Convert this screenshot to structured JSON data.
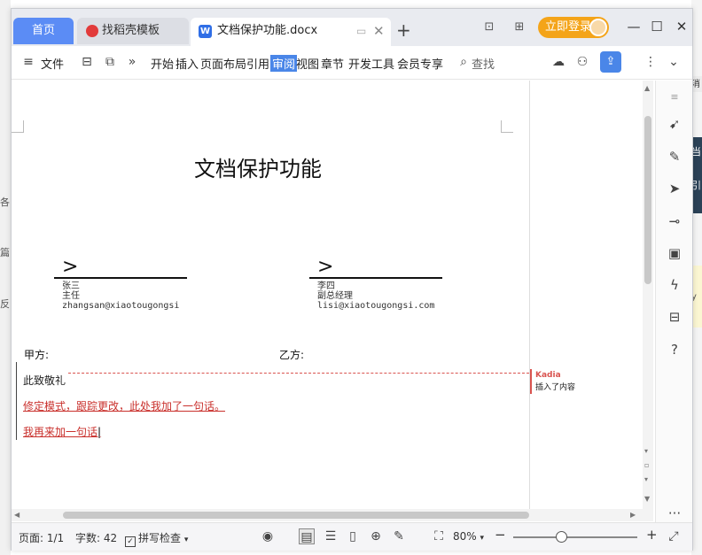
{
  "background": {
    "left_chars": [
      "各",
      "篇",
      "反"
    ],
    "right_chars": [
      "消",
      "当",
      "引",
      "y"
    ]
  },
  "titlebar": {
    "tab_home": "首页",
    "tab_template": "找稻壳模板",
    "tab_document": "文档保护功能.docx",
    "login_button": "立即登录"
  },
  "menubar": {
    "file": "文件",
    "tabs": [
      "开始",
      "插入",
      "页面布局",
      "引用",
      "审阅",
      "视图",
      "章节",
      "开发工具",
      "会员专享"
    ],
    "active_tab": "审阅",
    "search": "查找"
  },
  "document": {
    "title": "文档保护功能",
    "sig_left": {
      "name": "张三",
      "role": "主任",
      "email": "zhangsan@xiaotougongsi"
    },
    "sig_right": {
      "name": "李四",
      "role": "副总经理",
      "email": "lisi@xiaotougongsi.com"
    },
    "party_a": "甲方:",
    "party_b": "乙方:",
    "line1": "此致敬礼",
    "line2": "修定模式，跟踪更改，此处我加了一句话。",
    "line3": "我再来加一句话"
  },
  "comment": {
    "author": "Kadia",
    "text": "插入了内容"
  },
  "statusbar": {
    "page": "页面: 1/1",
    "word_count": "字数: 42",
    "spell_check": "拼写检查",
    "zoom": "80%"
  },
  "colors": {
    "accent": "#4a86e8",
    "revision": "#c9302c",
    "login": "#f4a419",
    "home_tab": "#5b8cf5"
  }
}
